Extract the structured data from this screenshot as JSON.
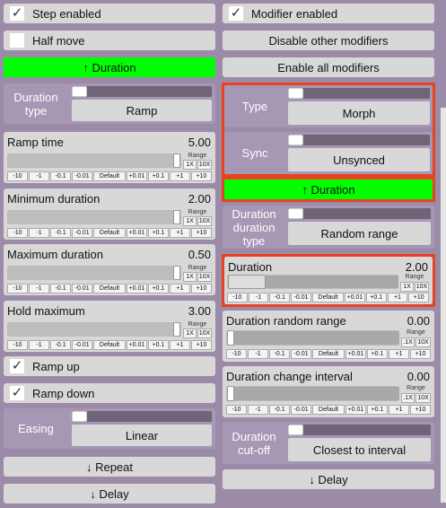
{
  "left": {
    "step_enabled": {
      "label": "Step enabled",
      "checked": true
    },
    "half_move": {
      "label": "Half move",
      "checked": false
    },
    "duration_button": "↑ Duration",
    "duration_type": {
      "label": "Duration\ntype",
      "value": "Ramp"
    },
    "ramp_time": {
      "label": "Ramp time",
      "value": "5.00"
    },
    "minimum_duration": {
      "label": "Minimum duration",
      "value": "2.00"
    },
    "maximum_duration": {
      "label": "Maximum duration",
      "value": "0.50"
    },
    "hold_maximum": {
      "label": "Hold maximum",
      "value": "3.00"
    },
    "ramp_up": {
      "label": "Ramp up",
      "checked": true
    },
    "ramp_down": {
      "label": "Ramp down",
      "checked": true
    },
    "easing": {
      "label": "Easing",
      "value": "Linear"
    },
    "repeat_button": "↓ Repeat",
    "delay_button": "↓ Delay"
  },
  "right": {
    "modifier_enabled": {
      "label": "Modifier enabled",
      "checked": true
    },
    "disable_others": "Disable other modifiers",
    "enable_all": "Enable all modifiers",
    "type": {
      "label": "Type",
      "value": "Morph"
    },
    "sync": {
      "label": "Sync",
      "value": "Unsynced"
    },
    "duration_button": "↑ Duration",
    "duration_duration_type": {
      "label": "Duration\nduration\ntype",
      "value": "Random range"
    },
    "duration": {
      "label": "Duration",
      "value": "2.00"
    },
    "duration_random_range": {
      "label": "Duration random range",
      "value": "0.00"
    },
    "duration_change_interval": {
      "label": "Duration change interval",
      "value": "0.00"
    },
    "duration_cutoff": {
      "label": "Duration\ncut-off",
      "value": "Closest to interval"
    },
    "delay_button": "↓ Delay"
  },
  "slider_controls": {
    "steps": [
      "-10",
      "-1",
      "-0.1",
      "-0.01",
      "Default",
      "+0.01",
      "+0.1",
      "+1",
      "+10"
    ],
    "range_label": "Range",
    "range_1x": "1X",
    "range_10x": "10X",
    "range_dot1x": ".1X"
  },
  "colors": {
    "accent_green": "#00ff00",
    "highlight_red": "#e8421e",
    "panel": "#9b8ba8"
  }
}
